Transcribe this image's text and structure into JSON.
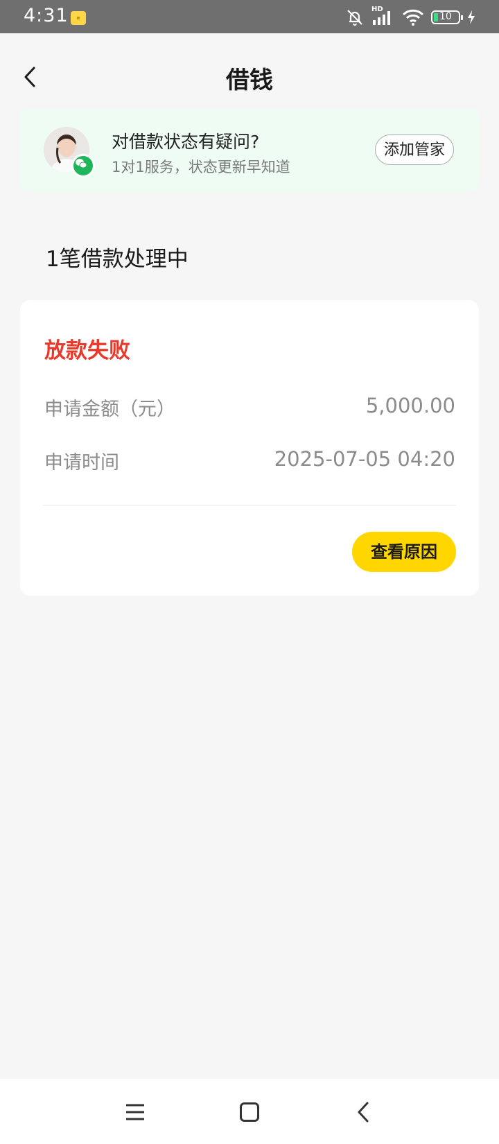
{
  "status_bar": {
    "time": "4:31",
    "network_label": "HD",
    "battery_level": "10",
    "icons": [
      "app-notification-icon",
      "mute-bell-icon",
      "signal-icon",
      "wifi-icon",
      "battery-icon",
      "charging-icon"
    ]
  },
  "header": {
    "back_icon": "chevron-left-icon",
    "title": "借钱"
  },
  "manager_banner": {
    "title": "对借款状态有疑问?",
    "subtitle": "1对1服务，状态更新早知道",
    "button_label": "添加管家",
    "background_color": "#eefcf4",
    "badge_icon": "wechat-icon"
  },
  "loans_section": {
    "title": "1笔借款处理中"
  },
  "loan_card": {
    "status": "放款失败",
    "status_color": "#e8392b",
    "rows": [
      {
        "label": "申请金额（元）",
        "value": "5,000.00"
      },
      {
        "label": "申请时间",
        "value": "2025-07-05 04:20"
      }
    ],
    "action_button": "查看原因",
    "action_color": "#ffd600"
  },
  "nav_bar": {
    "buttons": [
      "menu-icon",
      "home-icon",
      "back-icon"
    ]
  }
}
